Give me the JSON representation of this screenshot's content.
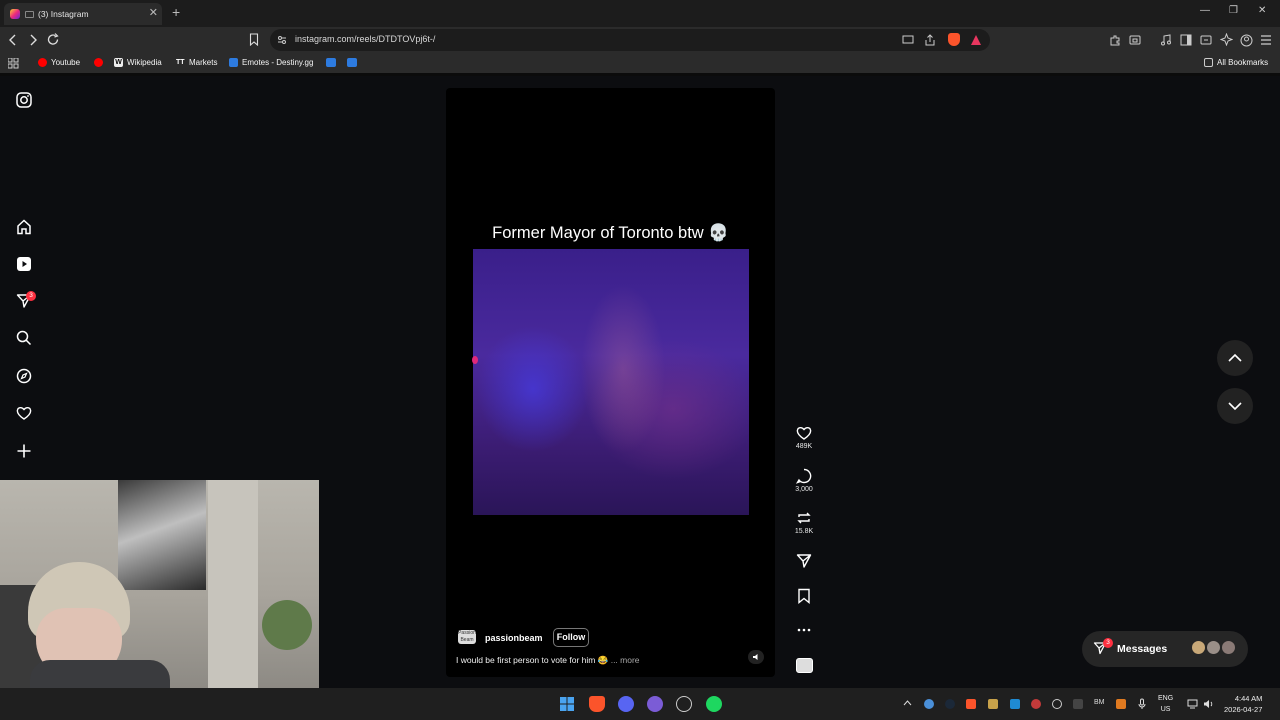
{
  "browser": {
    "tab_title": "(3) Instagram",
    "url": "instagram.com/reels/DTDTOVpj6t-/",
    "bookmarks": [
      "Youtube",
      "Wikipedia",
      "Markets",
      "Emotes - Destiny.gg"
    ],
    "all_bookmarks": "All Bookmarks"
  },
  "sidebar": {
    "items": [
      "instagram-logo",
      "home",
      "reels",
      "messages",
      "search",
      "explore",
      "notifications",
      "create"
    ],
    "messages_badge": "3"
  },
  "reel": {
    "caption_title": "Former Mayor of Toronto btw 💀",
    "author": "passionbeam",
    "author_avatar_text": "Passion Beam",
    "follow_label": "Follow",
    "caption": "I would be first person to vote for him 😂",
    "more_label": "... more",
    "likes": "489K",
    "comments": "3,000",
    "reposts": "15.8K"
  },
  "messages": {
    "label": "Messages",
    "badge": "3"
  },
  "taskbar": {
    "lang_top": "ENG",
    "lang_bottom": "US",
    "time": "4:44 AM",
    "date": "2026-04-27",
    "tray_label": "BM"
  },
  "colors": {
    "page_bg": "#0c0d10",
    "badge": "#ff3040",
    "video_purple": "#4a2a9e"
  }
}
